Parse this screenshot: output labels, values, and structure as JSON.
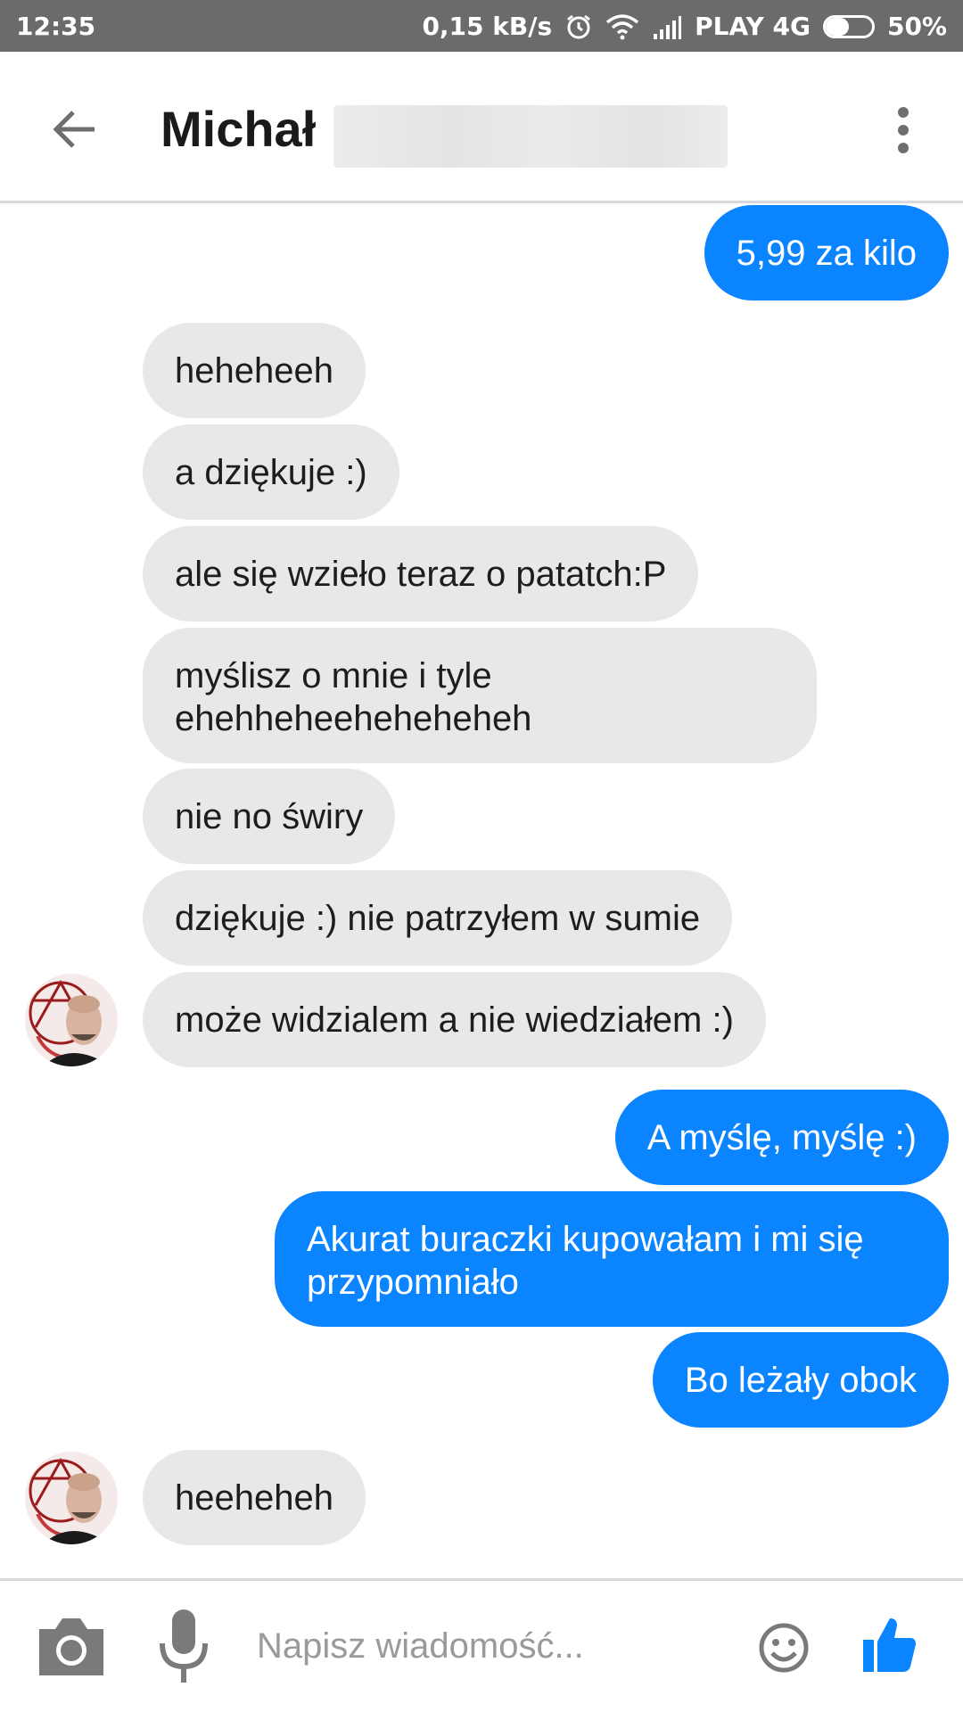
{
  "status_bar": {
    "time": "12:35",
    "speed": "0,15 kB/s",
    "carrier": "PLAY 4G",
    "battery_percent": "50%",
    "battery_level": 0.5,
    "icons": [
      "alarm-icon",
      "wifi-icon",
      "signal-icon",
      "battery-icon"
    ]
  },
  "header": {
    "contact_name": "Michał",
    "icons": [
      "back-arrow-icon",
      "more-vert-icon"
    ]
  },
  "messages": [
    {
      "id": "m1",
      "side": "outgoing",
      "text": "5,99 za kilo"
    },
    {
      "id": "m2",
      "side": "incoming",
      "text": "heheheeh"
    },
    {
      "id": "m3",
      "side": "incoming",
      "text": "a dziękuje :)"
    },
    {
      "id": "m4",
      "side": "incoming",
      "text": "ale się wzieło teraz o patatch:P"
    },
    {
      "id": "m5",
      "side": "incoming",
      "text": "myślisz o mnie i tyle ehehheheeheheheheh"
    },
    {
      "id": "m6",
      "side": "incoming",
      "text": "nie no świry"
    },
    {
      "id": "m7",
      "side": "incoming",
      "text": "dziękuje :) nie patrzyłem w sumie"
    },
    {
      "id": "m8",
      "side": "incoming",
      "text": "może widzialem a nie wiedziałem :)"
    },
    {
      "id": "m9",
      "side": "outgoing",
      "text": "A myślę, myślę :)"
    },
    {
      "id": "m10",
      "side": "outgoing",
      "text": "Akurat buraczki kupowałam i mi się przypomniało"
    },
    {
      "id": "m11",
      "side": "outgoing",
      "text": "Bo leżały obok"
    },
    {
      "id": "m12",
      "side": "incoming",
      "text": "heeheheh"
    }
  ],
  "composer": {
    "placeholder": "Napisz wiadomość...",
    "value": "",
    "icons": [
      "camera-icon",
      "microphone-icon",
      "emoji-icon",
      "thumbs-up-icon"
    ]
  },
  "colors": {
    "outgoing_bubble": "#0b84ff",
    "incoming_bubble": "#e8e8e8",
    "status_bar": "#6b6b6b",
    "icon_gray": "#7a7a7a",
    "like_blue": "#0b84ff"
  }
}
